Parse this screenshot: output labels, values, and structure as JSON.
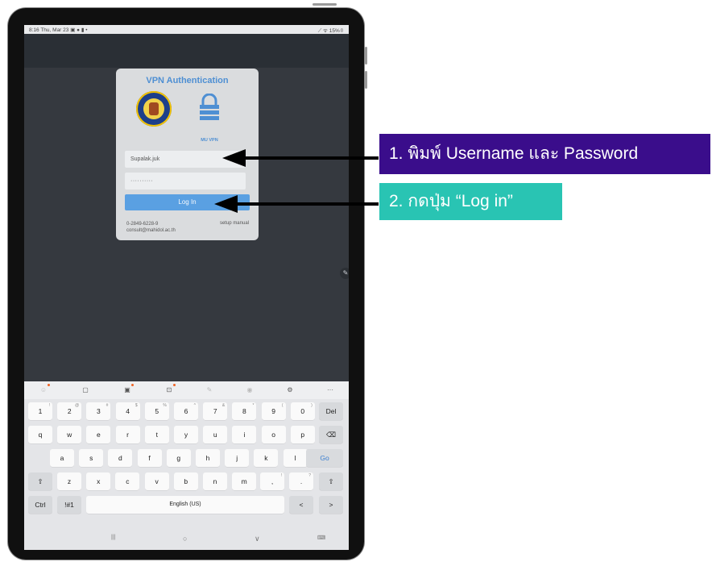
{
  "status_bar": {
    "left": "8:16  Thu, Mar 23  ▣ ● ▮ •",
    "right": "⟋ ᯤ 15%▯"
  },
  "dialog": {
    "title": "VPN Authentication",
    "lock_label": "MU VPN",
    "username_value": "Supalak.juk",
    "password_value": "··········",
    "login_label": "Log In",
    "phone": "0-2849-6228-9",
    "email": "consult@mahidol.ac.th",
    "setup_manual": "setup manual"
  },
  "keyboard": {
    "toolbar_icons": [
      "emoji-icon",
      "clipboard-icon",
      "sticker-icon",
      "translate-icon",
      "handwriting-icon",
      "microphone-icon",
      "settings-icon",
      "more-icon"
    ],
    "toolbar_more": "···",
    "row1": [
      {
        "k": "1",
        "s": "!"
      },
      {
        "k": "2",
        "s": "@"
      },
      {
        "k": "3",
        "s": "#"
      },
      {
        "k": "4",
        "s": "$"
      },
      {
        "k": "5",
        "s": "%"
      },
      {
        "k": "6",
        "s": "^"
      },
      {
        "k": "7",
        "s": "&"
      },
      {
        "k": "8",
        "s": "*"
      },
      {
        "k": "9",
        "s": "("
      },
      {
        "k": "0",
        "s": ")"
      }
    ],
    "del": "Del",
    "row2": [
      "q",
      "w",
      "e",
      "r",
      "t",
      "y",
      "u",
      "i",
      "o",
      "p"
    ],
    "backspace": "⌫",
    "row3": [
      "a",
      "s",
      "d",
      "f",
      "g",
      "h",
      "j",
      "k",
      "l"
    ],
    "go": "Go",
    "row4": [
      "z",
      "x",
      "c",
      "v",
      "b",
      "n",
      "m"
    ],
    "comma": ",",
    "comma_sup": "!",
    "period": ".",
    "period_sup": "?",
    "shift": "⇧",
    "ctrl": "Ctrl",
    "symbols": "!#1",
    "space": "English (US)",
    "left": "<",
    "right": ">"
  },
  "navbar": {
    "recents": "|||",
    "home": "○",
    "back": "∨",
    "keyboard": "⌨"
  },
  "annotations": {
    "step1": "1. พิมพ์ Username และ Password",
    "step2": "2. กดปุ่ม “Log in”"
  },
  "colors": {
    "callout1": "#3a0d8b",
    "callout2": "#29c4b3",
    "accent": "#5aa0e2"
  }
}
